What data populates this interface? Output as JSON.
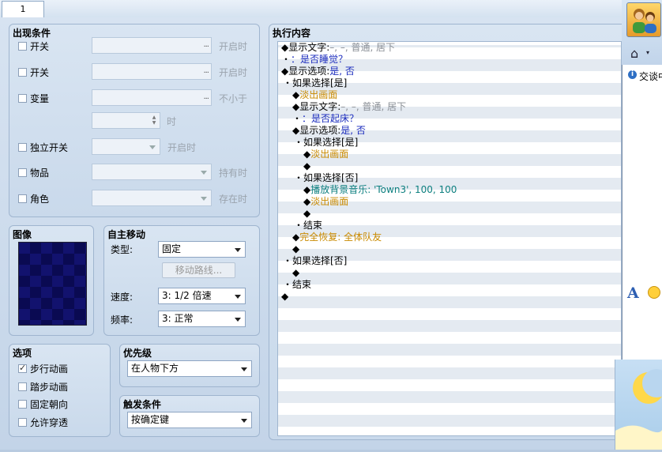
{
  "tab": {
    "label": "1"
  },
  "conditions": {
    "title": "出现条件",
    "rows": [
      {
        "label": "开关",
        "suffix": "开启时"
      },
      {
        "label": "开关",
        "suffix": "开启时"
      },
      {
        "label": "变量",
        "suffix": "不小于"
      },
      {
        "label": "独立开关",
        "suffix": "开启时"
      },
      {
        "label": "物品",
        "suffix": "持有时"
      },
      {
        "label": "角色",
        "suffix": "存在时"
      }
    ],
    "spin_suffix": "时"
  },
  "graphic": {
    "title": "图像"
  },
  "movement": {
    "title": "自主移动",
    "type_label": "类型:",
    "type_value": "固定",
    "route_button": "移动路线...",
    "speed_label": "速度:",
    "speed_value": "3: 1/2 倍速",
    "freq_label": "频率:",
    "freq_value": "3: 正常"
  },
  "options": {
    "title": "选项",
    "items": [
      {
        "label": "步行动画",
        "checked": true
      },
      {
        "label": "踏步动画",
        "checked": false
      },
      {
        "label": "固定朝向",
        "checked": false
      },
      {
        "label": "允许穿透",
        "checked": false
      }
    ]
  },
  "priority": {
    "title": "优先级",
    "value": "在人物下方"
  },
  "trigger": {
    "title": "触发条件",
    "value": "按确定键"
  },
  "contents": {
    "title": "执行内容",
    "lines": [
      {
        "p": "◆显示文字:",
        "t": "–, –, 普通, 居下",
        "c": "gtxt"
      },
      {
        "p": "・",
        "t": "：是否睡觉？",
        "c": "blue"
      },
      {
        "p": "◆显示选项:",
        "t": "是, 否",
        "c": "blue"
      },
      {
        "p": "・如果选择[是]",
        "t": "",
        "c": ""
      },
      {
        "p": "◆",
        "t": "淡出画面",
        "c": "gold"
      },
      {
        "p": "◆显示文字:",
        "t": "–, –, 普通, 居下",
        "c": "gtxt"
      },
      {
        "p": "・",
        "t": "：是否起床？",
        "c": "blue"
      },
      {
        "p": "◆显示选项:",
        "t": "是, 否",
        "c": "blue"
      },
      {
        "p": "・如果选择[是]",
        "t": "",
        "c": ""
      },
      {
        "p": "◆",
        "t": "淡出画面",
        "c": "gold"
      },
      {
        "p": "◆",
        "t": "",
        "c": ""
      },
      {
        "p": "・如果选择[否]",
        "t": "",
        "c": ""
      },
      {
        "p": "◆",
        "t": "播放背景音乐: 'Town3', 100, 100",
        "c": "teal"
      },
      {
        "p": "◆",
        "t": "淡出画面",
        "c": "gold"
      },
      {
        "p": "◆",
        "t": "",
        "c": ""
      },
      {
        "p": "・结束",
        "t": "",
        "c": ""
      },
      {
        "p": "◆",
        "t": "完全恢复: 全体队友",
        "c": "gold"
      },
      {
        "p": "◆",
        "t": "",
        "c": ""
      },
      {
        "p": "・如果选择[否]",
        "t": "",
        "c": ""
      },
      {
        "p": "◆",
        "t": "",
        "c": ""
      },
      {
        "p": "・结束",
        "t": "",
        "c": ""
      },
      {
        "p": "◆",
        "t": "",
        "c": ""
      }
    ]
  },
  "side": {
    "chat_label": "交谈中"
  }
}
